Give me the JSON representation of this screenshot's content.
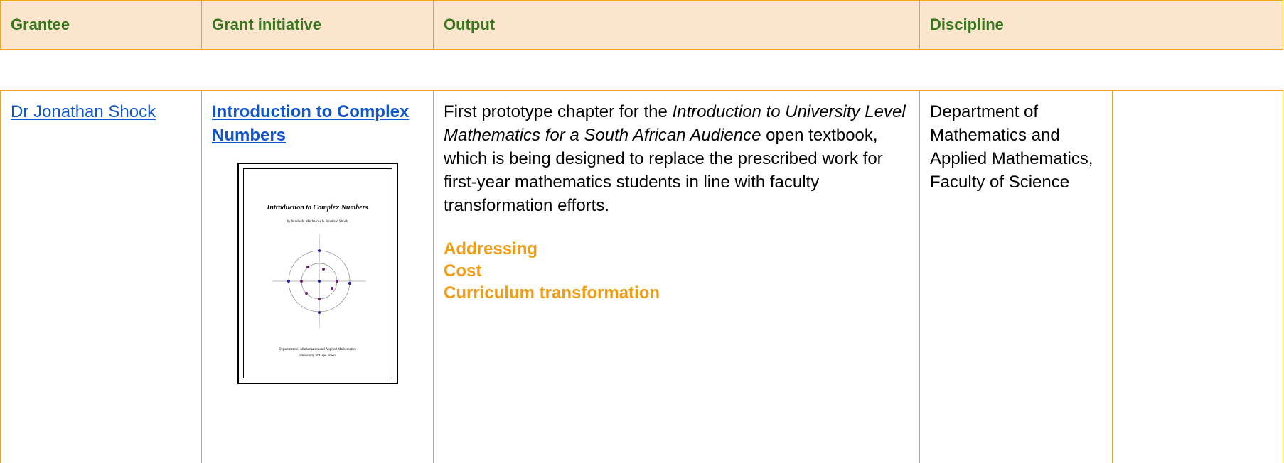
{
  "headers": {
    "grantee": "Grantee",
    "initiative": "Grant initiative",
    "output": "Output",
    "discipline": "Discipline"
  },
  "row": {
    "grantee": "Dr Jonathan Shock",
    "initiative": "Introduction to Complex Numbers",
    "output_pre": "First prototype chapter for the ",
    "output_italic": "Introduction to University Level Mathematics for a South African Audience",
    "output_post": " open textbook, which is being designed to replace the prescribed work for first-year mathematics students in line with faculty transformation efforts.",
    "tags": [
      "Addressing",
      "Cost",
      "Curriculum transformation"
    ],
    "discipline": "Department of Mathematics and Applied Mathematics, Faculty of Science"
  },
  "cover": {
    "title": "Introduction to Complex Numbers",
    "authors": "by Mashudu Makhafola & Jonathan Shock",
    "dept": "Department of Mathematics and Applied Mathematics",
    "university": "University of Cape Town"
  },
  "colors": {
    "border": "#f4a21c",
    "header_bg": "#fce5cd",
    "header_text": "#38761d",
    "link": "#1155cc",
    "tag": "#f39c12"
  }
}
